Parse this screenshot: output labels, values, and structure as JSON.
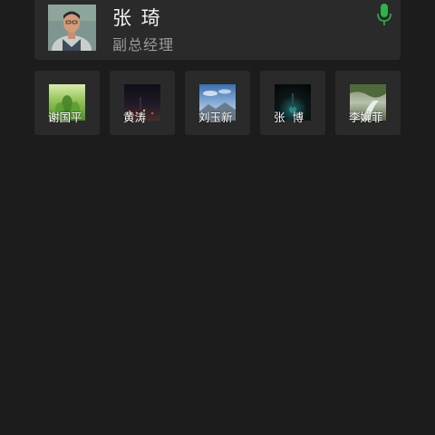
{
  "speaker": {
    "name": "张 琦",
    "role": "副总经理",
    "mic_icon": "microphone-icon",
    "mic_color": "#2fb24a"
  },
  "participants": [
    {
      "name": "谢国平",
      "thumb": "tea-field-photo"
    },
    {
      "name": "黄涛",
      "thumb": "night-city-photo"
    },
    {
      "name": "刘玉新",
      "thumb": "sky-mountain-photo"
    },
    {
      "name": "张  博",
      "thumb": "dark-night-photo"
    },
    {
      "name": "李婉菲",
      "thumb": "river-landscape-photo"
    }
  ],
  "colors": {
    "background": "#1c1c1c",
    "card": "#2a2a2a",
    "text_primary": "#f2f2f2",
    "text_secondary": "#9a9a9a"
  }
}
